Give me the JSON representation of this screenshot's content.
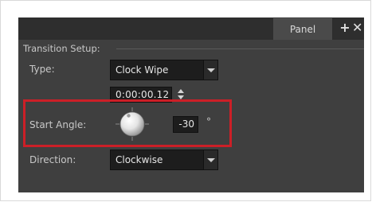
{
  "panel": {
    "tab_label": "Panel",
    "add_icon": "plus-icon",
    "close_icon": "close-icon"
  },
  "transition_setup": {
    "section_title": "Transition Setup:",
    "type": {
      "label": "Type:",
      "value": "Clock Wipe"
    },
    "duration": {
      "value": "0:00:00.12"
    },
    "start_angle": {
      "label": "Start Angle:",
      "value": "-30",
      "unit": "°"
    },
    "direction": {
      "label": "Direction:",
      "value": "Clockwise"
    }
  },
  "colors": {
    "panel_bg": "#3f3f3f",
    "field_bg": "#1d1d1d",
    "highlight": "#cc1f27"
  }
}
